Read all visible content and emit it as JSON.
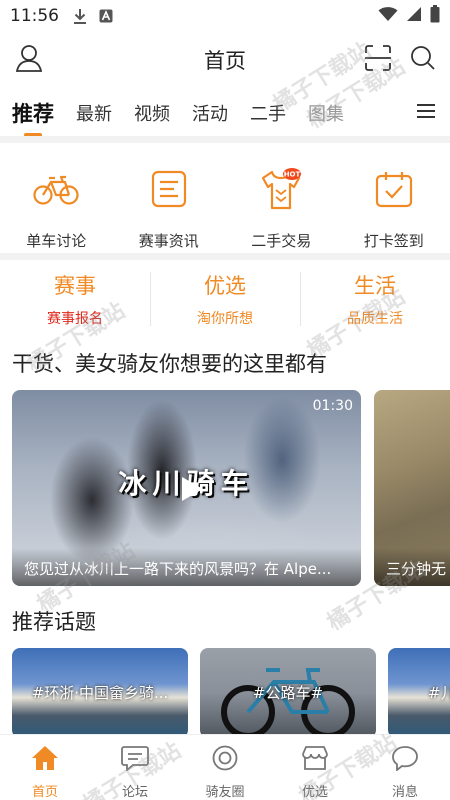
{
  "status": {
    "time": "11:56"
  },
  "header": {
    "title": "首页"
  },
  "tabs": [
    {
      "label": "推荐",
      "active": true
    },
    {
      "label": "最新"
    },
    {
      "label": "视频"
    },
    {
      "label": "活动"
    },
    {
      "label": "二手"
    },
    {
      "label": "图集"
    }
  ],
  "quick": [
    {
      "label": "单车讨论",
      "icon": "bicycle-icon"
    },
    {
      "label": "赛事资讯",
      "icon": "news-icon"
    },
    {
      "label": "二手交易",
      "icon": "jersey-hot-icon"
    },
    {
      "label": "打卡签到",
      "icon": "calendar-check-icon"
    }
  ],
  "categories": [
    {
      "title": "赛事",
      "subtitle": "赛事报名"
    },
    {
      "title": "优选",
      "subtitle": "淘你所想"
    },
    {
      "title": "生活",
      "subtitle": "品质生活"
    }
  ],
  "section1": {
    "title": "干货、美女骑友你想要的这里都有"
  },
  "videos": [
    {
      "overlay": "冰川骑车",
      "duration": "01:30",
      "caption": "您见过从冰川上一路下来的风景吗？在 Alpe..."
    },
    {
      "caption": "三分钟无"
    }
  ],
  "section2": {
    "title": "推荐话题"
  },
  "topics": [
    {
      "label": "#环浙·中国畲乡骑..."
    },
    {
      "label": "#公路车#"
    },
    {
      "label": "#儿"
    }
  ],
  "bottomnav": [
    {
      "label": "首页",
      "icon": "home-icon",
      "active": true
    },
    {
      "label": "论坛",
      "icon": "forum-icon"
    },
    {
      "label": "骑友圈",
      "icon": "circle-icon"
    },
    {
      "label": "优选",
      "icon": "store-icon"
    },
    {
      "label": "消息",
      "icon": "message-icon"
    }
  ],
  "watermark": "橘子下载站",
  "colors": {
    "accent": "#f08a24",
    "red": "#e0281c"
  }
}
